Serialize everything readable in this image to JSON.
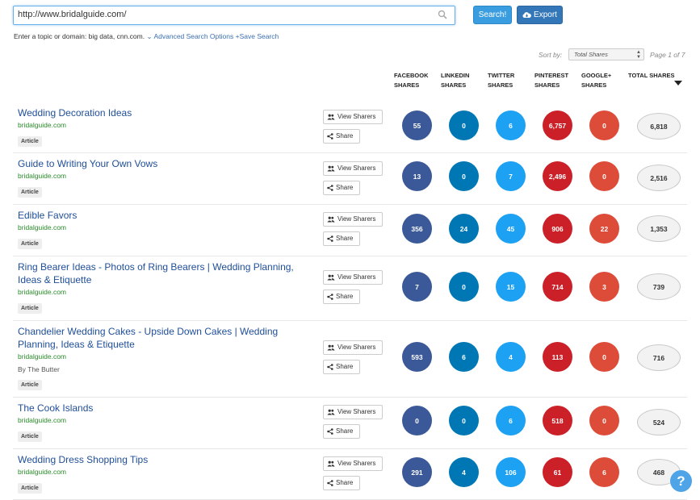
{
  "search": {
    "value": "http://www.bridalguide.com/",
    "search_label": "Search!",
    "export_label": "Export"
  },
  "hint": {
    "text": "Enter a topic or domain: big data, cnn.com.",
    "advanced": "Advanced Search Options",
    "save": "Save Search"
  },
  "sort": {
    "label": "Sort by:",
    "selected": "Total Shares",
    "page": "Page 1 of 7"
  },
  "columns": [
    [
      "FACEBOOK",
      "SHARES"
    ],
    [
      "LINKEDIN",
      "SHARES"
    ],
    [
      "TWITTER",
      "SHARES"
    ],
    [
      "PINTEREST",
      "SHARES"
    ],
    [
      "GOOGLE+",
      "SHARES"
    ],
    [
      "TOTAL SHARES",
      ""
    ]
  ],
  "colors": {
    "facebook": "#3b5998",
    "linkedin": "#0077b5",
    "twitter": "#1da1f2",
    "pinterest": "#cb2027",
    "google": "#dd4b39"
  },
  "buttons": {
    "view_sharers": "View Sharers",
    "share": "Share"
  },
  "rows": [
    {
      "title": "Wedding Decoration Ideas",
      "domain": "bridalguide.com",
      "author": "",
      "type": "Article",
      "facebook": "55",
      "linkedin": "0",
      "twitter": "6",
      "pinterest": "6,757",
      "google": "0",
      "total": "6,818"
    },
    {
      "title": "Guide to Writing Your Own Vows",
      "domain": "bridalguide.com",
      "author": "",
      "type": "Article",
      "facebook": "13",
      "linkedin": "0",
      "twitter": "7",
      "pinterest": "2,496",
      "google": "0",
      "total": "2,516"
    },
    {
      "title": "Edible Favors",
      "domain": "bridalguide.com",
      "author": "",
      "type": "Article",
      "facebook": "356",
      "linkedin": "24",
      "twitter": "45",
      "pinterest": "906",
      "google": "22",
      "total": "1,353"
    },
    {
      "title": "Ring Bearer Ideas - Photos of Ring Bearers | Wedding Planning, Ideas & Etiquette",
      "domain": "bridalguide.com",
      "author": "",
      "type": "Article",
      "facebook": "7",
      "linkedin": "0",
      "twitter": "15",
      "pinterest": "714",
      "google": "3",
      "total": "739"
    },
    {
      "title": "Chandelier Wedding Cakes - Upside Down Cakes | Wedding Planning, Ideas & Etiquette",
      "domain": "bridalguide.com",
      "author": "By The Butter",
      "type": "Article",
      "facebook": "593",
      "linkedin": "6",
      "twitter": "4",
      "pinterest": "113",
      "google": "0",
      "total": "716"
    },
    {
      "title": "The Cook Islands",
      "domain": "bridalguide.com",
      "author": "",
      "type": "Article",
      "facebook": "0",
      "linkedin": "0",
      "twitter": "6",
      "pinterest": "518",
      "google": "0",
      "total": "524"
    },
    {
      "title": "Wedding Dress Shopping Tips",
      "domain": "bridalguide.com",
      "author": "",
      "type": "Article",
      "facebook": "291",
      "linkedin": "4",
      "twitter": "106",
      "pinterest": "61",
      "google": "6",
      "total": "468"
    }
  ],
  "help": {
    "label": "?"
  }
}
